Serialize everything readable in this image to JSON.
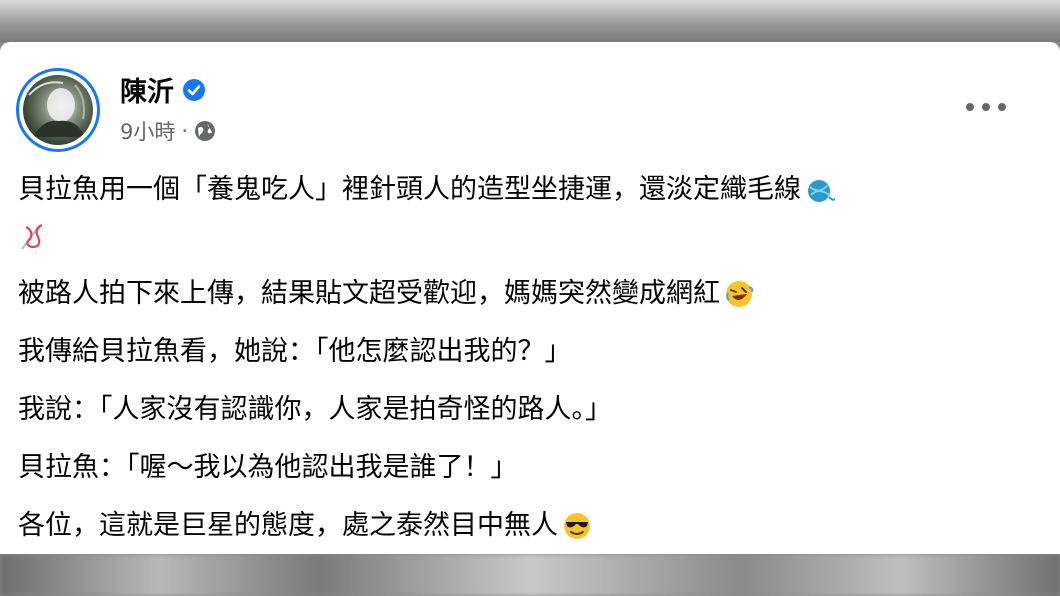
{
  "post": {
    "author_name": "陳沂",
    "time": "9小時",
    "separator": "·",
    "lines": [
      "貝拉魚用一個「養鬼吃人」裡針頭人的造型坐捷運，還淡定織毛線",
      "",
      "被路人拍下來上傳，結果貼文超受歡迎，媽媽突然變成網紅",
      "我傳給貝拉魚看，她說：「他怎麼認出我的？」",
      "我說：「人家沒有認識你，人家是拍奇怪的路人。」",
      "貝拉魚：「喔～我以為他認出我是誰了！」",
      "各位，這就是巨星的態度，處之泰然目中無人"
    ]
  },
  "icons": {
    "verified": "verified-badge-icon",
    "audience": "globe-icon",
    "more": "more-options-icon",
    "emoji_yarn": "yarn-ball-emoji",
    "emoji_needles": "knitting-needles-emoji",
    "emoji_laugh": "rolling-laughing-emoji",
    "emoji_cool": "sunglasses-emoji"
  },
  "colors": {
    "accent": "#1877f2",
    "text": "#050505",
    "secondary": "#65676b"
  }
}
